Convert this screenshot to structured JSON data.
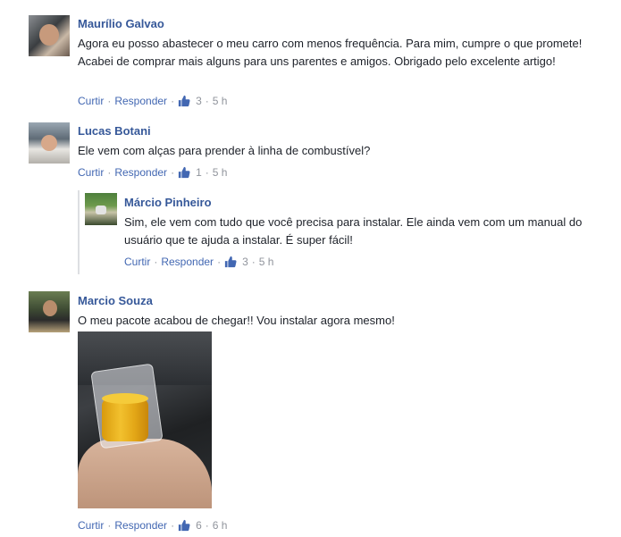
{
  "comments": [
    {
      "name": "Maurílio Galvao",
      "text": "Agora eu posso abastecer o meu carro com menos frequência. Para mim, cumpre o que promete! Acabei de comprar mais alguns para uns parentes e amigos. Obrigado pelo excelente artigo!",
      "like_label": "Curtir",
      "reply_label": "Responder",
      "likes": "3",
      "time": "5 h"
    },
    {
      "name": "Lucas Botani",
      "text": "Ele vem com alças para prender à linha de combustível?",
      "like_label": "Curtir",
      "reply_label": "Responder",
      "likes": "1",
      "time": "5 h"
    },
    {
      "name": "Márcio Pinheiro",
      "text": "Sim, ele vem com tudo que você precisa para instalar. Ele ainda vem com um manual do usuário que te ajuda a instalar. É super fácil!",
      "like_label": "Curtir",
      "reply_label": "Responder",
      "likes": "3",
      "time": "5 h"
    },
    {
      "name": "Marcio Souza",
      "text": "O meu pacote acabou de chegar!! Vou instalar agora mesmo!",
      "like_label": "Curtir",
      "reply_label": "Responder",
      "likes": "6",
      "time": "6 h"
    }
  ],
  "colors": {
    "name": "#365899",
    "link": "#4267b2",
    "meta": "#90949c",
    "text": "#1d2129"
  },
  "icons": {
    "like": "thumbs-up-icon"
  }
}
